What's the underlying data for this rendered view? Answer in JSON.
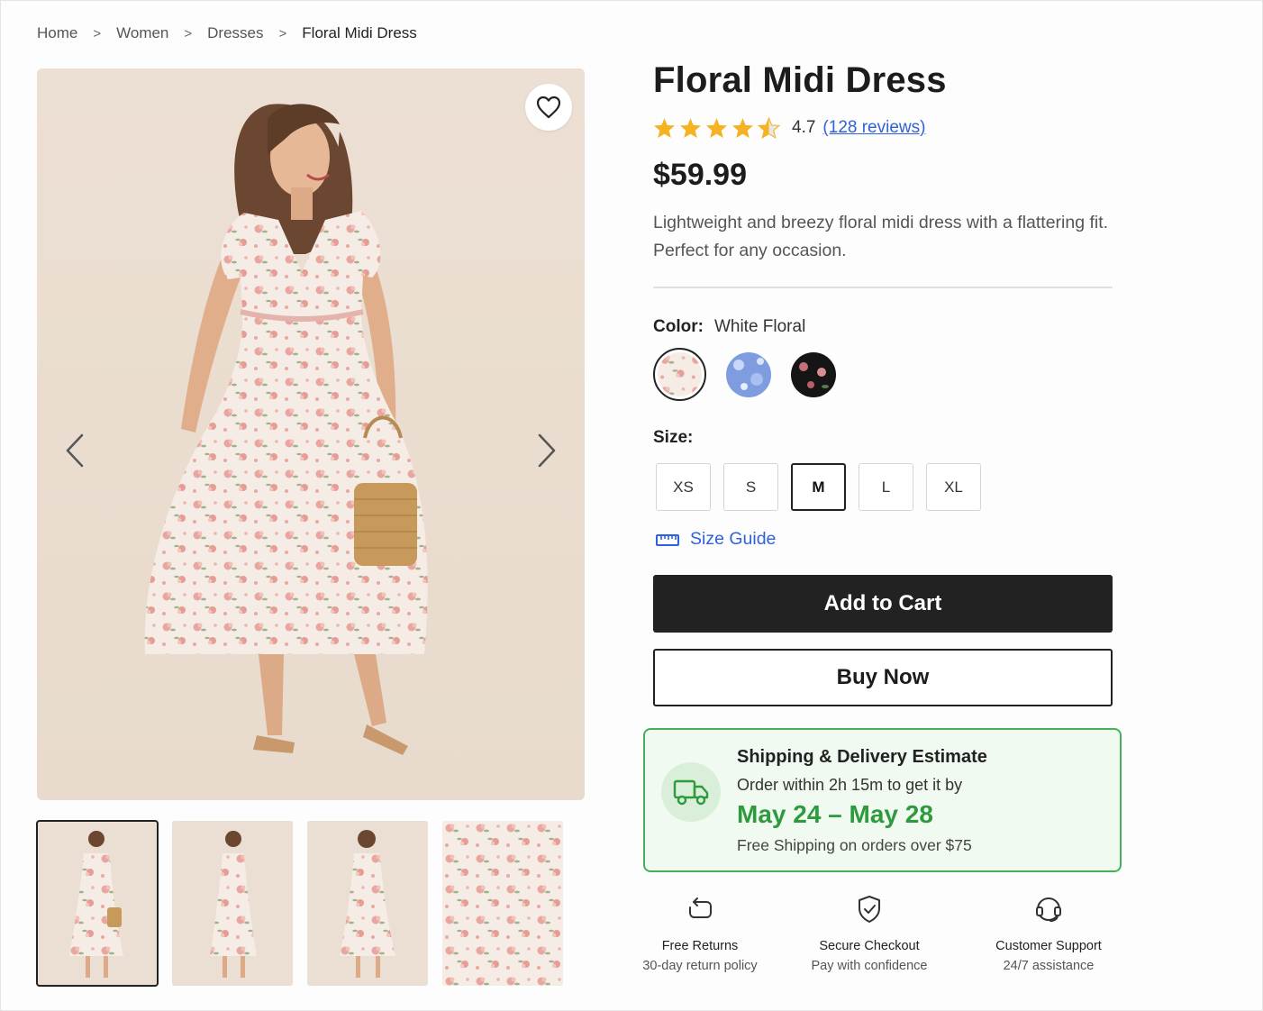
{
  "breadcrumb": {
    "items": [
      "Home",
      "Women",
      "Dresses"
    ],
    "separator": ">",
    "current": "Floral Midi Dress"
  },
  "gallery": {
    "wishlist_icon": "heart-icon",
    "prev_icon": "chevron-left-icon",
    "next_icon": "chevron-right-icon",
    "thumbnail_count": 4,
    "active_thumbnail": 1
  },
  "product": {
    "title": "Floral Midi Dress",
    "rating_value": "4.7",
    "rating_stars": 4.5,
    "reviews_label": "(128 reviews)",
    "price": "$59.99",
    "description": "Lightweight and breezy floral midi dress with a flattering fit. Perfect for any occasion."
  },
  "color": {
    "label": "Color:",
    "selected": "White Floral",
    "swatches": [
      "White Floral",
      "Blue Floral",
      "Black Floral"
    ]
  },
  "size": {
    "label": "Size:",
    "options": [
      "XS",
      "S",
      "M",
      "L",
      "XL"
    ],
    "selected": "M",
    "guide_label": "Size Guide"
  },
  "actions": {
    "add_to_cart": "Add to Cart",
    "buy_now": "Buy Now"
  },
  "shipping": {
    "title": "Shipping & Delivery Estimate",
    "subtitle": "Order within 2h 15m to get it by",
    "date_range": "May 24 – May 28",
    "free_note": "Free Shipping on orders over $75",
    "accent": "#2e9a3e"
  },
  "features": [
    {
      "title": "Free Returns",
      "subtitle": "30-day return policy",
      "icon": "return-icon"
    },
    {
      "title": "Secure Checkout",
      "subtitle": "Pay with confidence",
      "icon": "shield-check-icon"
    },
    {
      "title": "Customer Support",
      "subtitle": "24/7 assistance",
      "icon": "headset-icon"
    }
  ]
}
